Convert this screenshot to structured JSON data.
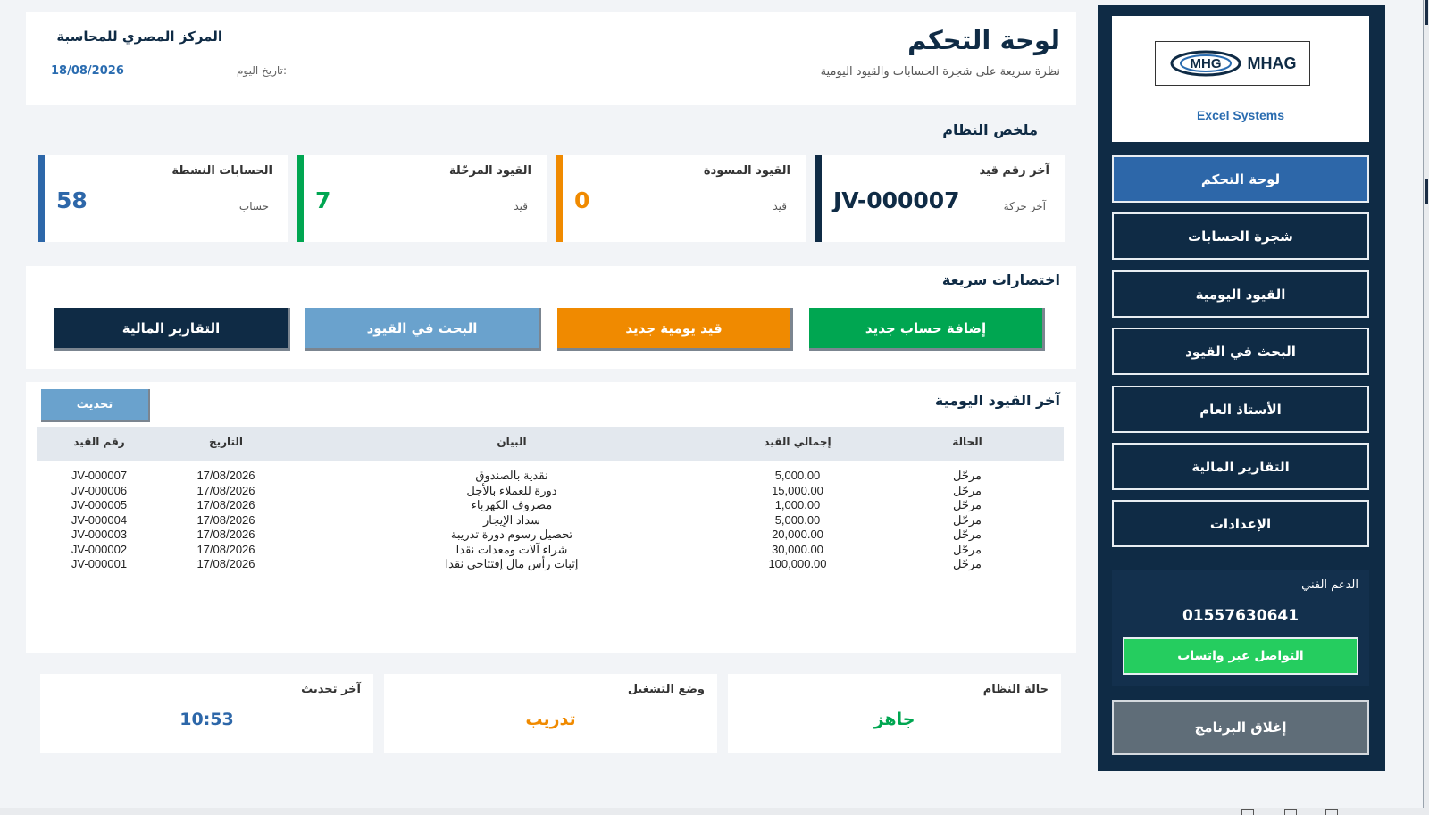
{
  "colors": {
    "navy": "#0f2b45",
    "blue": "#2d67a9",
    "green": "#00a651",
    "orange": "#f08a00",
    "lightblue": "#6aa2cd",
    "whatsapp": "#25cd5f",
    "gray": "#5f6d78"
  },
  "header": {
    "title": "لوحة التحكم",
    "subtitle": "نظرة سريعة على شجرة الحسابات والقيود اليومية",
    "company": "المركز المصري للمحاسبة",
    "date_label": "تاريخ اليوم:",
    "date": "18/08/2026"
  },
  "sidebar": {
    "logo": {
      "mark": "MHAG",
      "subtitle": "Excel Systems"
    },
    "items": [
      {
        "label": "لوحة التحكم",
        "active": true
      },
      {
        "label": "شجرة الحسابات"
      },
      {
        "label": "القيود اليومية"
      },
      {
        "label": "البحث في القيود"
      },
      {
        "label": "الأستاذ العام"
      },
      {
        "label": "التقارير المالية"
      },
      {
        "label": "الإعدادات"
      }
    ],
    "support": {
      "title": "الدعم الفني",
      "phone": "01557630641",
      "whatsapp_label": "التواصل عبر واتساب"
    },
    "close_label": "إغلاق البرنامج"
  },
  "summary": {
    "title": "ملخص النظام",
    "cards": [
      {
        "label": "آخر رقم قيد",
        "unit": "آخر حركة",
        "value": "JV-000007",
        "color": "#0f2b45"
      },
      {
        "label": "القيود المسودة",
        "unit": "قيد",
        "value": "0",
        "color": "#f08a00"
      },
      {
        "label": "القيود المرحّلة",
        "unit": "قيد",
        "value": "7",
        "color": "#00a651"
      },
      {
        "label": "الحسابات النشطة",
        "unit": "حساب",
        "value": "58",
        "color": "#2d67a9"
      }
    ]
  },
  "shortcuts": {
    "title": "اختصارات سريعة",
    "buttons": [
      {
        "label": "إضافة حساب جديد",
        "color": "#00a651"
      },
      {
        "label": "قيد يومية جديد",
        "color": "#f08a00"
      },
      {
        "label": "البحث في القيود",
        "color": "#6aa2cd"
      },
      {
        "label": "التقارير المالية",
        "color": "#0f2b45"
      }
    ]
  },
  "journal": {
    "title": "آخر القيود اليومية",
    "refresh_label": "تحديث",
    "columns": [
      "الحالة",
      "إجمالي القيد",
      "البيان",
      "التاريخ",
      "رقم القيد"
    ],
    "rows": [
      {
        "status": "مرحّل",
        "total": "5,000.00",
        "desc": "نقدية بالصندوق",
        "date": "17/08/2026",
        "no": "JV-000007"
      },
      {
        "status": "مرحّل",
        "total": "15,000.00",
        "desc": "دورة للعملاء بالأجل",
        "date": "17/08/2026",
        "no": "JV-000006"
      },
      {
        "status": "مرحّل",
        "total": "1,000.00",
        "desc": "مصروف الكهرباء",
        "date": "17/08/2026",
        "no": "JV-000005"
      },
      {
        "status": "مرحّل",
        "total": "5,000.00",
        "desc": "سداد الإيجار",
        "date": "17/08/2026",
        "no": "JV-000004"
      },
      {
        "status": "مرحّل",
        "total": "20,000.00",
        "desc": "تحصيل رسوم دورة تدريبة",
        "date": "17/08/2026",
        "no": "JV-000003"
      },
      {
        "status": "مرحّل",
        "total": "30,000.00",
        "desc": "شراء آلات ومعدات نقدا",
        "date": "17/08/2026",
        "no": "JV-000002"
      },
      {
        "status": "مرحّل",
        "total": "100,000.00",
        "desc": "إثبات رأس مال إفتتاحي نقدا",
        "date": "17/08/2026",
        "no": "JV-000001"
      }
    ]
  },
  "status": {
    "system_label": "حالة النظام",
    "system_value": "جاهز",
    "mode_label": "وضع التشغيل",
    "mode_value": "تدريب",
    "update_label": "آخر تحديث",
    "update_value": "10:53"
  }
}
